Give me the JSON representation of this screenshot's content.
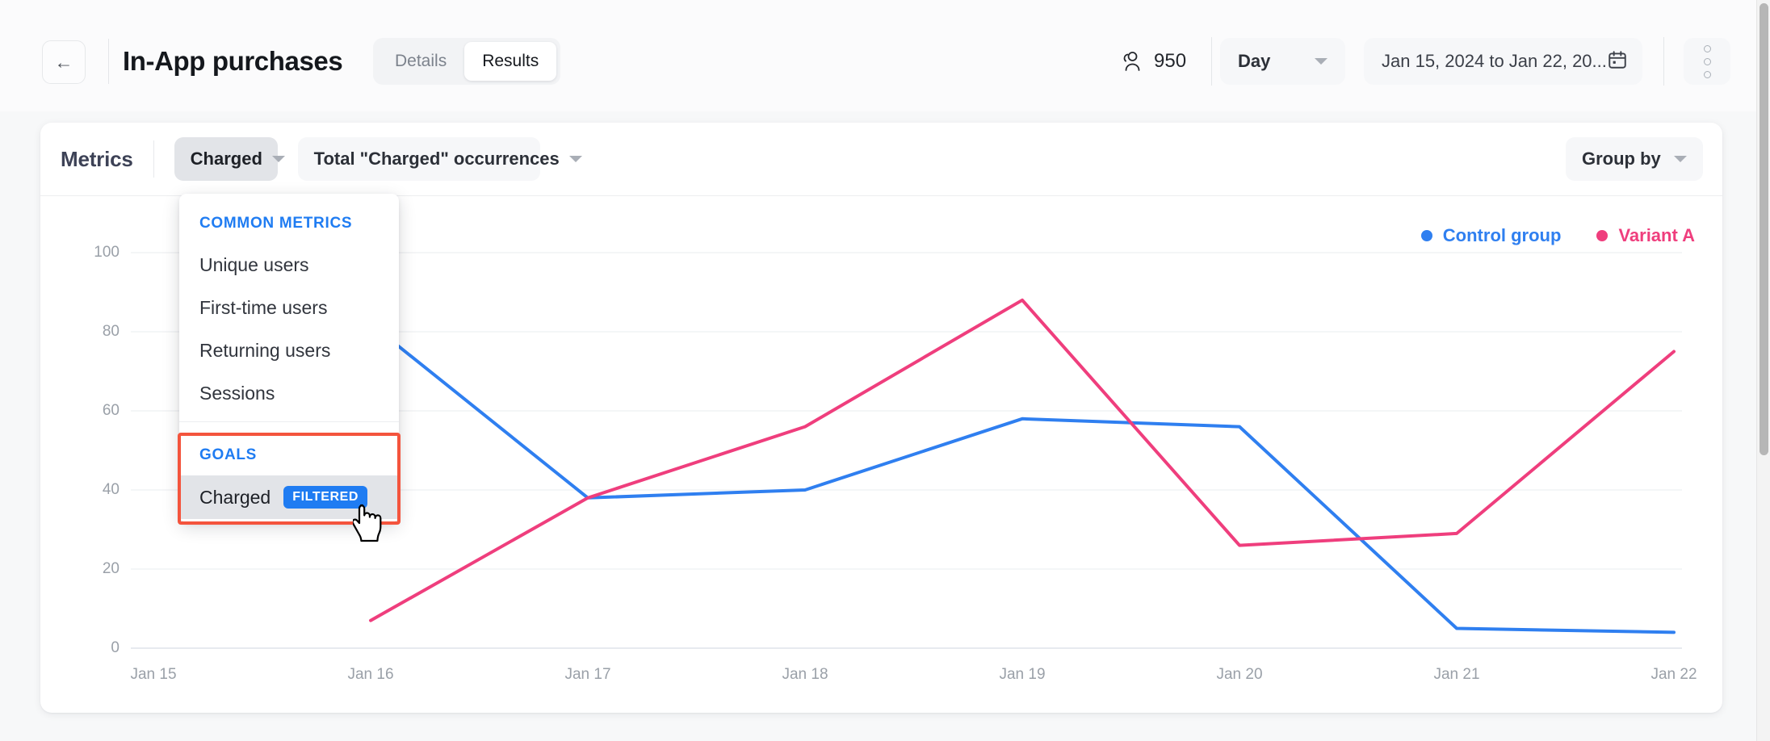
{
  "header": {
    "back_icon": "arrow-left-icon",
    "title": "In-App purchases",
    "tabs": [
      {
        "label": "Details",
        "active": false
      },
      {
        "label": "Results",
        "active": true
      }
    ],
    "users_icon": "users-icon",
    "users_count": "950",
    "granularity": {
      "label": "Day",
      "caret": "chevron-down-icon"
    },
    "date_range": {
      "label": "Jan 15, 2024 to Jan 22, 20...",
      "icon": "calendar-icon"
    },
    "more_icon": "kebab-menu-icon"
  },
  "card": {
    "metrics_label": "Metrics",
    "metric_select": {
      "label": "Charged",
      "caret": "chevron-down-icon"
    },
    "aggregation_select": {
      "label": "Total \"Charged\" occurrences",
      "caret": "chevron-down-icon"
    },
    "group_by": {
      "label": "Group by",
      "caret": "chevron-down-icon"
    }
  },
  "dropdown": {
    "sections": [
      {
        "title": "COMMON METRICS",
        "items": [
          {
            "label": "Unique users"
          },
          {
            "label": "First-time users"
          },
          {
            "label": "Returning users"
          },
          {
            "label": "Sessions"
          }
        ]
      },
      {
        "title": "GOALS",
        "items": [
          {
            "label": "Charged",
            "badge": "FILTERED",
            "highlighted": true
          }
        ]
      }
    ],
    "highlight_color": "#f4543d",
    "section_title_color": "#1f7cf2",
    "badge_color": "#1f7cf2"
  },
  "chart_data": {
    "type": "line",
    "title": "",
    "xlabel": "",
    "ylabel": "",
    "categories": [
      "Jan 15",
      "Jan 16",
      "Jan 17",
      "Jan 18",
      "Jan 19",
      "Jan 20",
      "Jan 21",
      "Jan 22"
    ],
    "ylim": [
      0,
      100
    ],
    "yticks": [
      0,
      20,
      40,
      60,
      80,
      100
    ],
    "grid": true,
    "legend_position": "top-right",
    "series": [
      {
        "name": "Control group",
        "color": "#2f7ff0",
        "values": [
          null,
          82,
          38,
          40,
          58,
          56,
          5,
          4
        ]
      },
      {
        "name": "Variant A",
        "color": "#ef3e7d",
        "values": [
          null,
          7,
          38,
          56,
          88,
          26,
          29,
          75
        ]
      }
    ]
  },
  "cursor": {
    "icon": "pointing-hand-cursor"
  }
}
